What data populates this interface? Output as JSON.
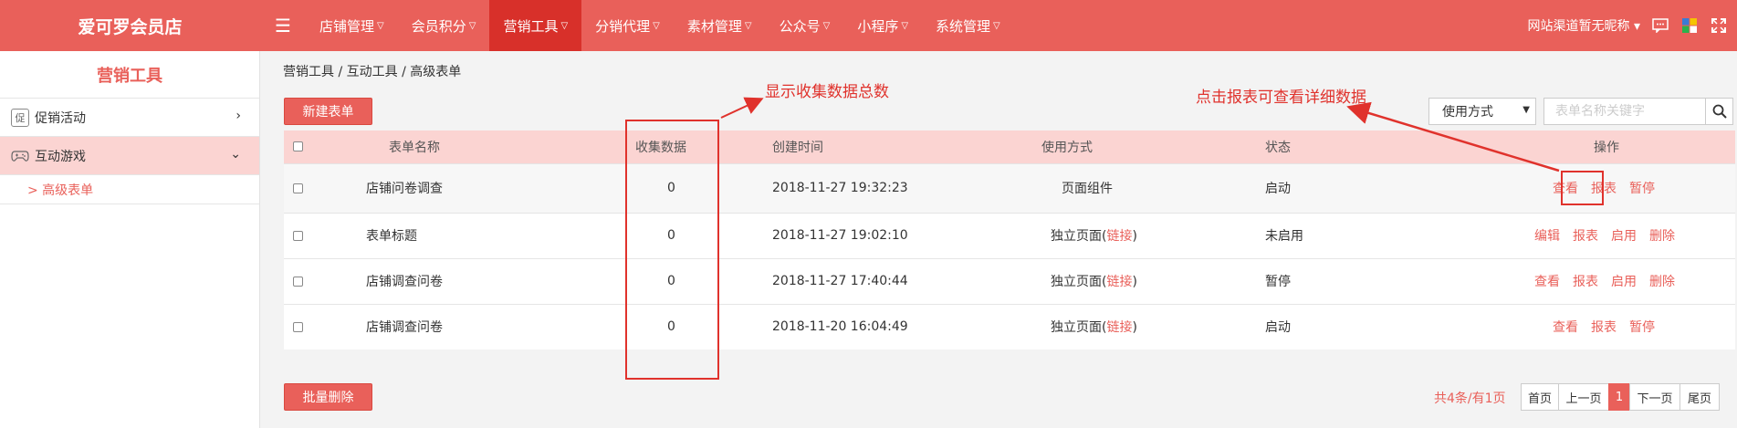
{
  "brand": "爱可罗会员店",
  "nav": [
    {
      "label": "店铺管理",
      "active": false
    },
    {
      "label": "会员积分",
      "active": false
    },
    {
      "label": "营销工具",
      "active": true
    },
    {
      "label": "分销代理",
      "active": false
    },
    {
      "label": "素材管理",
      "active": false
    },
    {
      "label": "公众号",
      "active": false
    },
    {
      "label": "小程序",
      "active": false
    },
    {
      "label": "系统管理",
      "active": false
    }
  ],
  "topright": {
    "channel": "网站渠道暂无昵称"
  },
  "sidebar": {
    "title": "营销工具",
    "items": [
      {
        "label": "促销活动",
        "icon": "促"
      },
      {
        "label": "互动游戏",
        "icon": "gamepad-icon"
      }
    ],
    "sub": "> 高级表单"
  },
  "breadcrumb": "营销工具 / 互动工具 / 高级表单",
  "buttons": {
    "new": "新建表单",
    "batch_delete": "批量删除"
  },
  "filter": {
    "select_value": "使用方式",
    "search_placeholder": "表单名称关键字"
  },
  "table": {
    "headers": [
      "表单名称",
      "收集数据",
      "创建时间",
      "使用方式",
      "状态",
      "操作"
    ],
    "rows": [
      {
        "name": "店铺问卷调查",
        "count": "0",
        "time": "2018-11-27 19:32:23",
        "use": "页面组件",
        "link": "",
        "status": "启动",
        "ops": [
          "查看",
          "报表",
          "暂停"
        ]
      },
      {
        "name": "表单标题",
        "count": "0",
        "time": "2018-11-27 19:02:10",
        "use": "独立页面(",
        "link": "链接",
        "status": "未启用",
        "ops": [
          "编辑",
          "报表",
          "启用",
          "删除"
        ]
      },
      {
        "name": "店铺调查问卷",
        "count": "0",
        "time": "2018-11-27 17:40:44",
        "use": "独立页面(",
        "link": "链接",
        "status": "暂停",
        "ops": [
          "查看",
          "报表",
          "启用",
          "删除"
        ]
      },
      {
        "name": "店铺调查问卷",
        "count": "0",
        "time": "2018-11-20 16:04:49",
        "use": "独立页面(",
        "link": "链接",
        "status": "启动",
        "ops": [
          "查看",
          "报表",
          "暂停"
        ]
      }
    ]
  },
  "pager": {
    "info": "共4条/有1页",
    "pages": [
      "首页",
      "上一页",
      "1",
      "下一页",
      "尾页"
    ]
  },
  "annotations": {
    "count_note": "显示收集数据总数",
    "report_note": "点击报表可查看详细数据"
  },
  "colors": {
    "accent": "#e9605a",
    "nav_active": "#d8302a",
    "annotation": "#e0322c"
  }
}
